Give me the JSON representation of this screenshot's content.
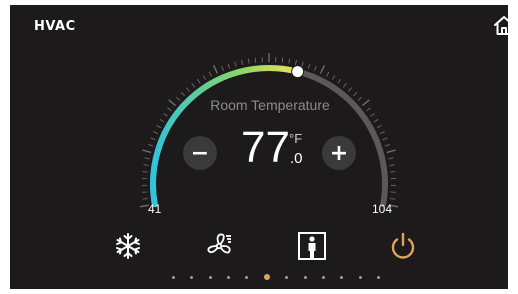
{
  "header": {
    "title": "HVAC",
    "home_icon": "home-icon"
  },
  "thermostat": {
    "label": "Room Temperature",
    "temp_int": "77",
    "temp_dec": ".0",
    "unit": "°F",
    "min_label": "41",
    "max_label": "104",
    "min_value": 41,
    "max_value": 104,
    "setpoint": 77.0,
    "minus_label": "−",
    "plus_label": "+"
  },
  "modes": [
    {
      "icon": "snowflake-icon",
      "active": false
    },
    {
      "icon": "fan-icon",
      "active": false
    },
    {
      "icon": "occupancy-icon",
      "active": false
    },
    {
      "icon": "power-icon",
      "active": true
    }
  ],
  "pager": {
    "count": 12,
    "active_index": 5
  },
  "colors": {
    "background": "#1c1a1a",
    "arc_cool": "#2ec3e0",
    "arc_mid": "#8fd35a",
    "arc_warm": "#f2e05a",
    "arc_track": "#5a5858",
    "accent": "#e0a35a"
  }
}
